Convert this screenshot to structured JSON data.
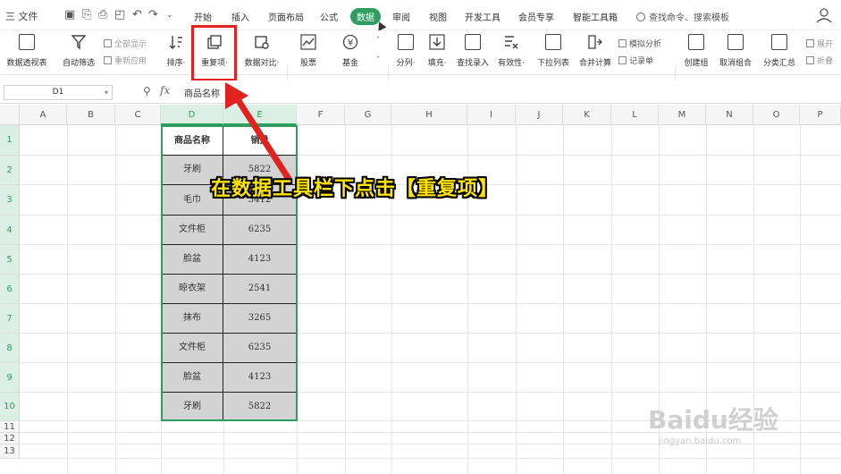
{
  "menubar": {
    "file_label": "三 文件",
    "tabs": [
      "开始",
      "插入",
      "页面布局",
      "公式",
      "数据",
      "审阅",
      "视图",
      "开发工具",
      "会员专享",
      "智能工具箱"
    ],
    "active_tab": "数据",
    "search_placeholder": "查找命令、搜索模板"
  },
  "ribbon": {
    "pivot_label": "数据透视表",
    "autofilter_label": "自动筛选",
    "show_all_label": "全部显示",
    "reapply_label": "重新应用",
    "sort_label": "排序·",
    "duplicates_label": "重复项·",
    "compare_label": "数据对比·",
    "stock_label": "股票",
    "fund_label": "基金",
    "split_label": "分列·",
    "fill_label": "填充·",
    "lookup_label": "查找录入",
    "validity_label": "有效性·",
    "dropdown_label": "下拉列表",
    "consolidate_label": "合并计算",
    "whatif_label": "模拟分析",
    "record_label": "记录单",
    "group_label": "创建组",
    "ungroup_label": "取消组合",
    "subtotal_label": "分类汇总",
    "expand_label": "展开",
    "collapse_label": "折叠"
  },
  "formula_bar": {
    "name_box": "D1",
    "fx_label": "fx",
    "value": "商品名称"
  },
  "grid": {
    "columns": [
      "A",
      "B",
      "C",
      "D",
      "E",
      "F",
      "G",
      "H",
      "I",
      "J",
      "K",
      "L",
      "M",
      "N",
      "O",
      "P"
    ],
    "rows": [
      "1",
      "2",
      "3",
      "4",
      "5",
      "6",
      "7",
      "8",
      "9",
      "10",
      "11",
      "12",
      "13"
    ],
    "table": {
      "headers": [
        "商品名称",
        "销量"
      ],
      "rows": [
        [
          "牙刷",
          "5822"
        ],
        [
          "毛巾",
          "3412"
        ],
        [
          "文件柜",
          "6235"
        ],
        [
          "脸盆",
          "4123"
        ],
        [
          "晾衣架",
          "2541"
        ],
        [
          "抹布",
          "3265"
        ],
        [
          "文件柜",
          "6235"
        ],
        [
          "脸盆",
          "4123"
        ],
        [
          "牙刷",
          "5822"
        ]
      ]
    }
  },
  "annotation": {
    "text": "在数据工具栏下点击【重复项】",
    "color": "#ffe400"
  },
  "watermark": {
    "brand": "Baidu经验",
    "url": "jingyan.baidu.com"
  },
  "colors": {
    "accent": "#2e9d5f",
    "highlight_box": "#e22121",
    "cell_fill": "#d3d3d3"
  }
}
